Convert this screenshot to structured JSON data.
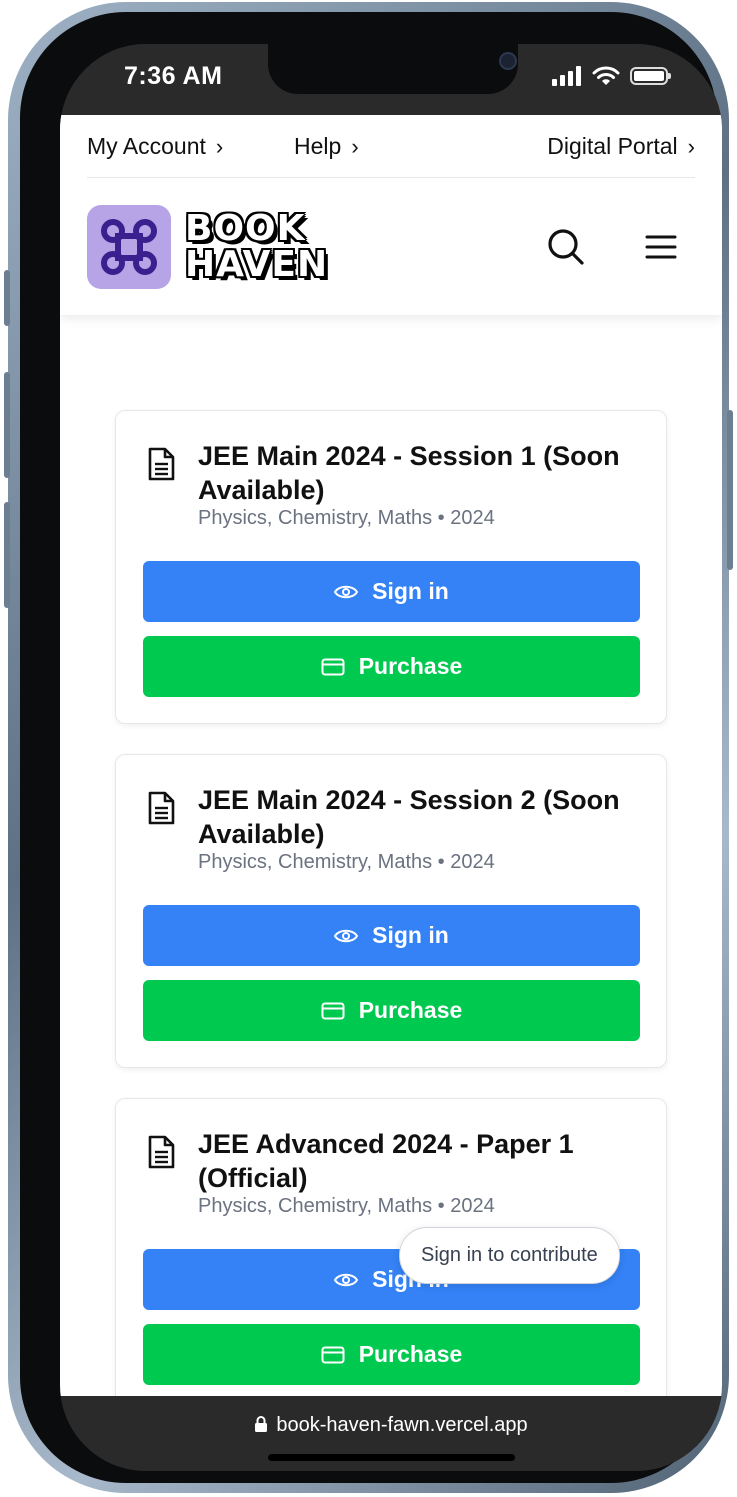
{
  "status_bar": {
    "time": "7:36 AM"
  },
  "top_nav": {
    "my_account": "My Account",
    "help": "Help",
    "digital_portal": "Digital Portal",
    "chevron": "›"
  },
  "brand": {
    "line1": "BOOK",
    "line2": "HAVEN",
    "logo_color": "#b7a4e6"
  },
  "icons": {
    "search": "search-icon",
    "menu": "hamburger-menu-icon",
    "document": "document-icon",
    "eye": "eye-icon",
    "card": "credit-card-icon",
    "lock": "lock-icon"
  },
  "colors": {
    "primary": "#3482f6",
    "success": "#00c950"
  },
  "papers": [
    {
      "title": "JEE Main 2024 - Session 1 (Soon Available)",
      "subtitle": "Physics, Chemistry, Maths • 2024",
      "sign_in_label": "Sign in",
      "purchase_label": "Purchase"
    },
    {
      "title": "JEE Main 2024 - Session 2 (Soon Available)",
      "subtitle": "Physics, Chemistry, Maths • 2024",
      "sign_in_label": "Sign in",
      "purchase_label": "Purchase"
    },
    {
      "title": "JEE Advanced 2024 - Paper 1 (Official)",
      "subtitle": "Physics, Chemistry, Maths • 2024",
      "sign_in_label": "Sign in",
      "purchase_label": "Purchase"
    }
  ],
  "toast": {
    "label": "Sign in to contribute"
  },
  "browser": {
    "url": "book-haven-fawn.vercel.app"
  }
}
